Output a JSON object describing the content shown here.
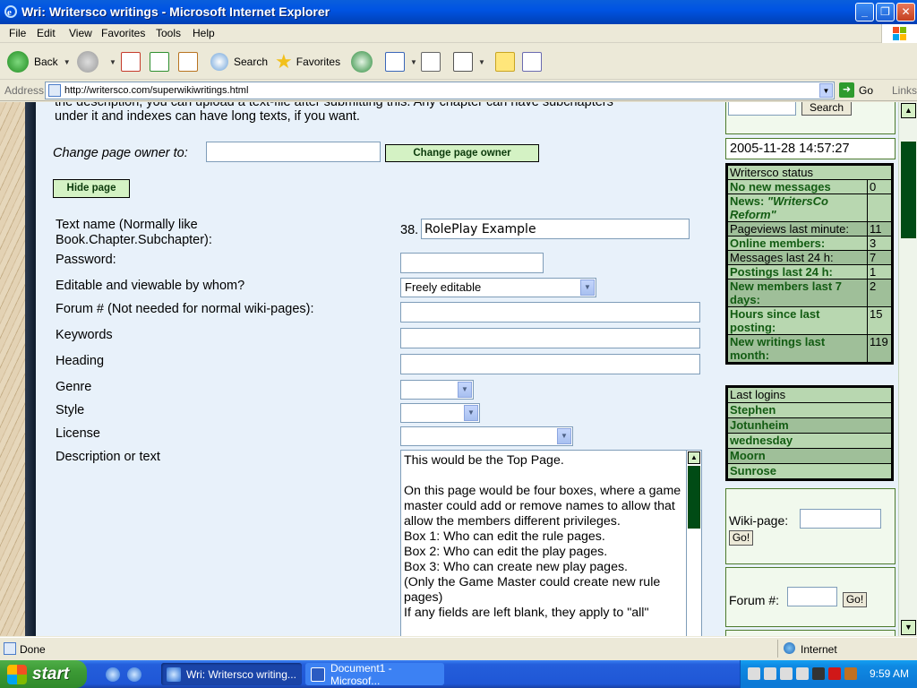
{
  "window": {
    "title": "Wri: Writersco writings - Microsoft Internet Explorer"
  },
  "menu": [
    "File",
    "Edit",
    "View",
    "Favorites",
    "Tools",
    "Help"
  ],
  "toolbar": {
    "back": "Back",
    "search": "Search",
    "favorites": "Favorites"
  },
  "address": {
    "label": "Address",
    "url": "http://writersco.com/superwikiwritings.html",
    "go": "Go",
    "links": "Links"
  },
  "page": {
    "intro_line1": "the description, you can upload a text-file after submitting this. Any chapter can have subchapters",
    "intro_line2": "under it and indexes can have long texts, if you want.",
    "change_owner_label": "Change page owner to:",
    "change_owner_value": "",
    "change_owner_button": "Change page owner",
    "hide_page_button": "Hide page",
    "text_name_label_1": "Text name (Normally like",
    "text_name_label_2": "Book.Chapter.Subchapter):",
    "text_name_prefix": "38.",
    "text_name_value": "RolePlay Example",
    "password_label": "Password:",
    "password_value": "",
    "editable_label": "Editable and viewable by whom?",
    "editable_value": "Freely editable",
    "forum_label": "Forum # (Not needed for normal wiki-pages):",
    "forum_value": "",
    "keywords_label": "Keywords",
    "keywords_value": "",
    "heading_label": "Heading",
    "heading_value": "",
    "genre_label": "Genre",
    "genre_value": "",
    "style_label": "Style",
    "style_value": "",
    "license_label": "License",
    "license_value": "",
    "description_label": "Description or text",
    "description_text": "This would be the Top Page.\n\nOn this page would be four boxes, where a game master could add or remove names to allow that allow the members different privileges.\nBox 1: Who can edit the rule pages.\nBox 2: Who can edit the play pages.\nBox 3: Who can create new play pages.\n(Only the Game Master could create new rule pages)\nIf any fields are left blank, they apply to \"all\""
  },
  "sidebar": {
    "search_value": "",
    "search_button": "Search",
    "datetime": "2005-11-28 14:57:27",
    "status_title": "Writersco status",
    "status_rows": [
      {
        "key": "No new messages",
        "value": "0"
      },
      {
        "key_prefix": "News: ",
        "key_italic": "\"WritersCo Reform\"",
        "value": ""
      },
      {
        "key": "Pageviews last minute:",
        "value": "11"
      },
      {
        "key": "Online members:",
        "value": "3"
      },
      {
        "key": "Messages last 24 h:",
        "value": "7"
      },
      {
        "key": "Postings last 24 h:",
        "value": "1"
      },
      {
        "key": "New members last 7 days:",
        "value": "2"
      },
      {
        "key": "Hours since last posting:",
        "value": "15"
      },
      {
        "key": "New writings last month:",
        "value": "119"
      }
    ],
    "logins_title": "Last logins",
    "logins": [
      "Stephen",
      "Jotunheim",
      "wednesday",
      "Moorn",
      "Sunrose"
    ],
    "wiki_label": "Wiki-page:",
    "wiki_value": "",
    "wiki_go": "Go!",
    "forum_label": "Forum #:",
    "forum_value": "",
    "forum_go": "Go!"
  },
  "statusbar": {
    "text": "Done",
    "zone": "Internet"
  },
  "taskbar": {
    "start": "start",
    "tasks": [
      "Wri: Writersco writing...",
      "Document1 - Microsof..."
    ],
    "clock": "9:59 AM"
  }
}
